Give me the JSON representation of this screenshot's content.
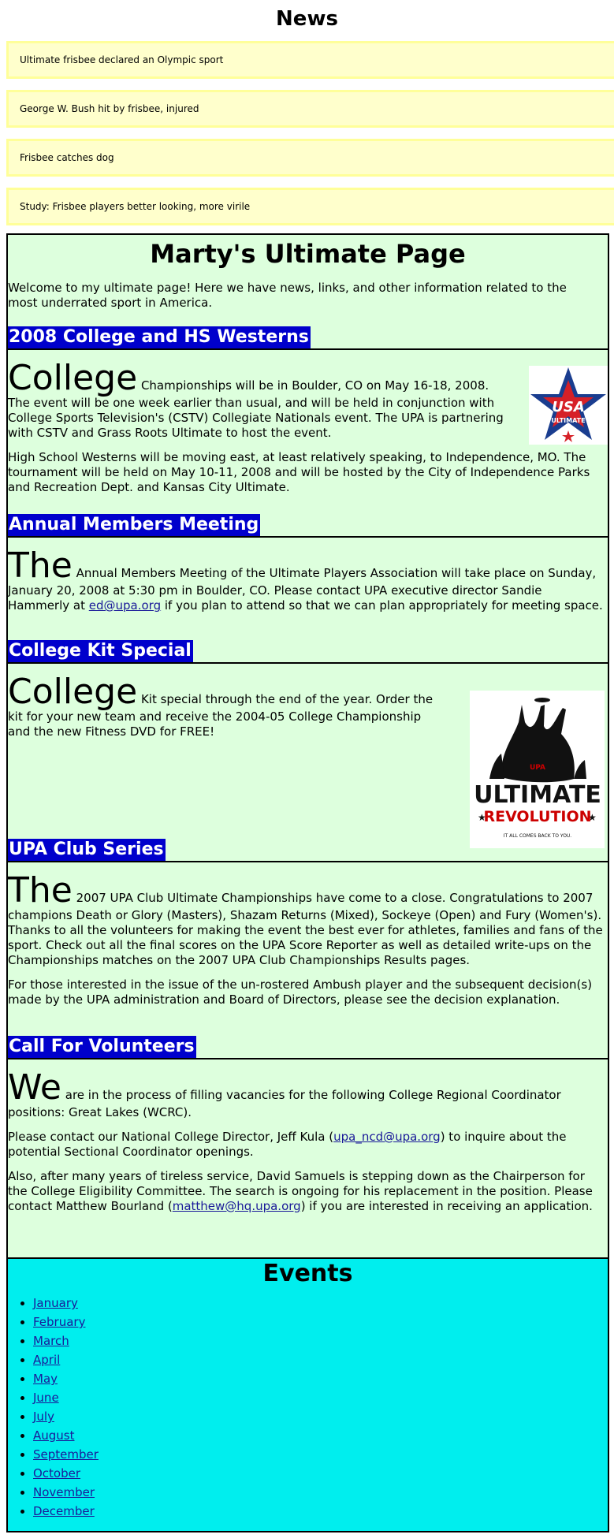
{
  "news": {
    "title": "News",
    "items": [
      "Ultimate frisbee declared an Olympic sport",
      "George W. Bush hit by frisbee, injured",
      "Frisbee catches dog",
      "Study: Frisbee players better looking, more virile"
    ]
  },
  "main": {
    "title": "Marty's Ultimate Page",
    "intro": "Welcome to my ultimate page! Here we have news, links, and other information related to the most underrated sport in America.",
    "sections": [
      {
        "heading": "2008 College and HS Westerns",
        "dropcap": "College",
        "p1": " Championships will be in Boulder, CO on May 16-18, 2008. The event will be one week earlier than usual, and will be held in conjunction with College Sports Television's (CSTV) Collegiate Nationals event. The UPA is partnering with CSTV and Grass Roots Ultimate to host the event.",
        "p2": "High School Westerns will be moving east, at least relatively speaking, to Independence, MO. The tournament will be held on May 10-11, 2008 and will be hosted by the City of Independence Parks and Recreation Dept. and Kansas City Ultimate.",
        "image_text": "USA ULTIMATE"
      },
      {
        "heading": "Annual Members Meeting",
        "dropcap": "The",
        "p1a": " Annual Members Meeting of the Ultimate Players Association will take place on Sunday, January 20, 2008 at 5:30 pm in Boulder, CO. Please contact UPA executive director Sandie Hammerly at ",
        "link": "ed@upa.org",
        "p1b": " if you plan to attend so that we can plan appropriately for meeting space."
      },
      {
        "heading": "College Kit Special",
        "dropcap": "College",
        "p1": " Kit special through the end of the year. Order the kit for your new team and receive the 2004-05 College Championship and the new Fitness DVD for FREE!",
        "image_title": "ULTIMATE",
        "image_subtitle": "REVOLUTION",
        "image_tagline": "IT ALL COMES BACK TO YOU.",
        "image_badge": "UPA"
      },
      {
        "heading": "UPA Club Series",
        "dropcap": "The",
        "p1": " 2007 UPA Club Ultimate Championships have come to a close. Congratulations to 2007 champions Death or Glory (Masters), Shazam Returns (Mixed), Sockeye (Open) and Fury (Women's). Thanks to all the volunteers for making the event the best ever for athletes, families and fans of the sport. Check out all the final scores on the UPA Score Reporter as well as detailed write-ups on the Championships matches on the 2007 UPA Club Championships Results pages.",
        "p2": "For those interested in the issue of the un-rostered Ambush player and the subsequent decision(s) made by the UPA administration and Board of Directors, please see the decision explanation."
      },
      {
        "heading": "Call For Volunteers",
        "dropcap": "We",
        "p1": " are in the process of filling vacancies for the following College Regional Coordinator positions: Great Lakes (WCRC).",
        "p2a": "Please contact our National College Director, Jeff Kula (",
        "p2link": "upa_ncd@upa.org",
        "p2b": ") to inquire about the potential Sectional Coordinator openings.",
        "p3a": "Also, after many years of tireless service, David Samuels is stepping down as the Chairperson for the College Eligibility Committee. The search is ongoing for his replacement in the position. Please contact Matthew Bourland (",
        "p3link": "matthew@hq.upa.org",
        "p3b": ") if you are interested in receiving an application."
      }
    ]
  },
  "events": {
    "title": "Events",
    "months": [
      "January",
      "February",
      "March",
      "April",
      "May",
      "June",
      "July",
      "August",
      "September",
      "October",
      "November",
      "December"
    ]
  },
  "colors": {
    "news_bg": "#ffffcc",
    "main_bg": "#ddffdd",
    "heading_bg": "#0000cc",
    "events_bg": "#00eeee"
  }
}
